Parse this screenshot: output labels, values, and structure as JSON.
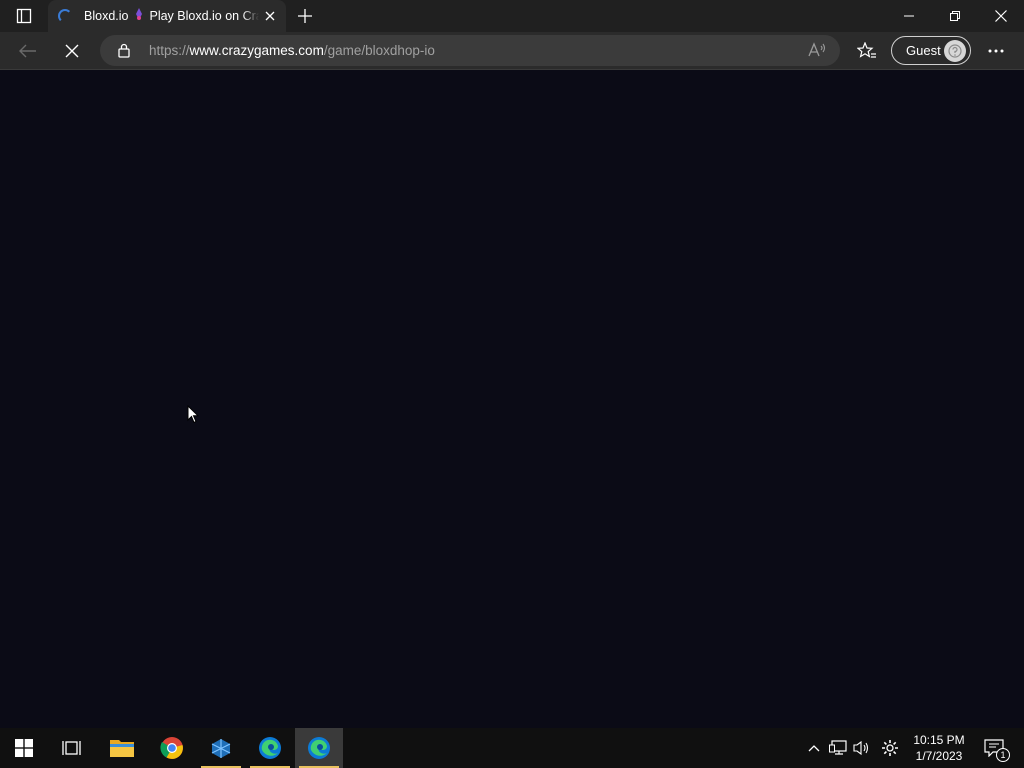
{
  "browser": {
    "tab": {
      "title_primary": "Bloxd.io",
      "title_secondary": "Play Bloxd.io on CrazyGames"
    },
    "address_bar": {
      "url_prefix": "https://",
      "url_domain": "www.crazygames.com",
      "url_path": "/game/bloxdhop-io"
    },
    "profile": {
      "label": "Guest"
    }
  },
  "page": {
    "background_color": "#0b0b16"
  },
  "taskbar": {
    "pinned": [
      "start-icon",
      "task-view-icon",
      "file-explorer-icon",
      "chrome-icon",
      "app-icon",
      "edge-icon",
      "edge-icon"
    ],
    "clock": {
      "time": "10:15 PM",
      "date": "1/7/2023"
    },
    "notification_count": "1"
  }
}
